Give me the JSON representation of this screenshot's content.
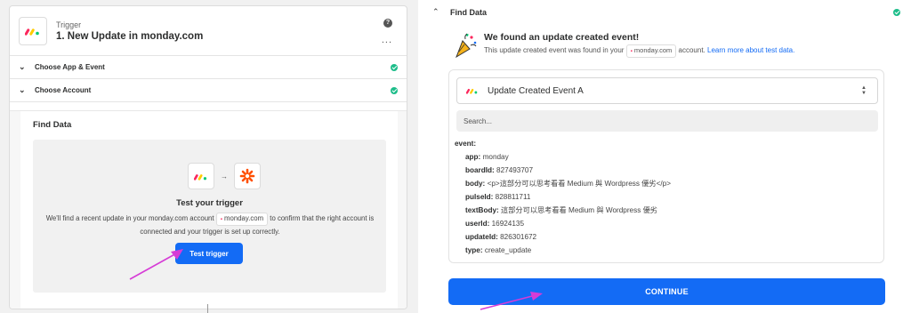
{
  "left": {
    "trigger_kind": "Trigger",
    "trigger_title": "1. New Update in monday.com",
    "help_symbol": "?",
    "more_symbol": "...",
    "sections": [
      {
        "label": "Choose App & Event",
        "completed": true
      },
      {
        "label": "Choose Account",
        "completed": true
      }
    ],
    "find_data_label": "Find Data",
    "test_title": "Test your trigger",
    "test_desc_1": "We'll find a recent update in your monday.com account",
    "test_desc_app": "monday.com",
    "test_desc_2": "to confirm that the right account is connected and your trigger is set up correctly.",
    "test_button": "Test trigger"
  },
  "right": {
    "find_data_label": "Find Data",
    "found_title": "We found an update created event!",
    "found_desc_1": "This update created event was found in your",
    "found_desc_app": "monday.com",
    "found_desc_2": "account.",
    "learn_more_link": "Learn more about test data.",
    "selected_event": "Update Created Event A",
    "search_placeholder": "Search...",
    "event_root": "event:",
    "fields": [
      {
        "key": "app:",
        "value": "monday"
      },
      {
        "key": "boardId:",
        "value": "827493707"
      },
      {
        "key": "body:",
        "value": "<p>這部分可以思考看看 Medium 與 Wordpress 優劣</p>"
      },
      {
        "key": "pulseId:",
        "value": "828811711"
      },
      {
        "key": "textBody:",
        "value": "這部分可以思考看看 Medium 與 Wordpress 優劣"
      },
      {
        "key": "userId:",
        "value": "16924135"
      },
      {
        "key": "updateId:",
        "value": "826301672"
      },
      {
        "key": "type:",
        "value": "create_update"
      }
    ],
    "continue_button": "CONTINUE"
  },
  "colors": {
    "accent": "#136bf5",
    "success": "#1dbd8a",
    "annotation": "#d63cd6",
    "monday_red": "#fb275d",
    "monday_yellow": "#ffcb00",
    "monday_green": "#00ca72",
    "zapier_orange": "#ff4f00"
  },
  "icons": [
    "monday-logo-icon",
    "zapier-logo-icon",
    "arrow-right-icon",
    "help-icon",
    "more-icon",
    "chevron-down-icon",
    "chevron-up-icon",
    "check-circle-icon",
    "party-popper-icon",
    "updown-icon"
  ]
}
